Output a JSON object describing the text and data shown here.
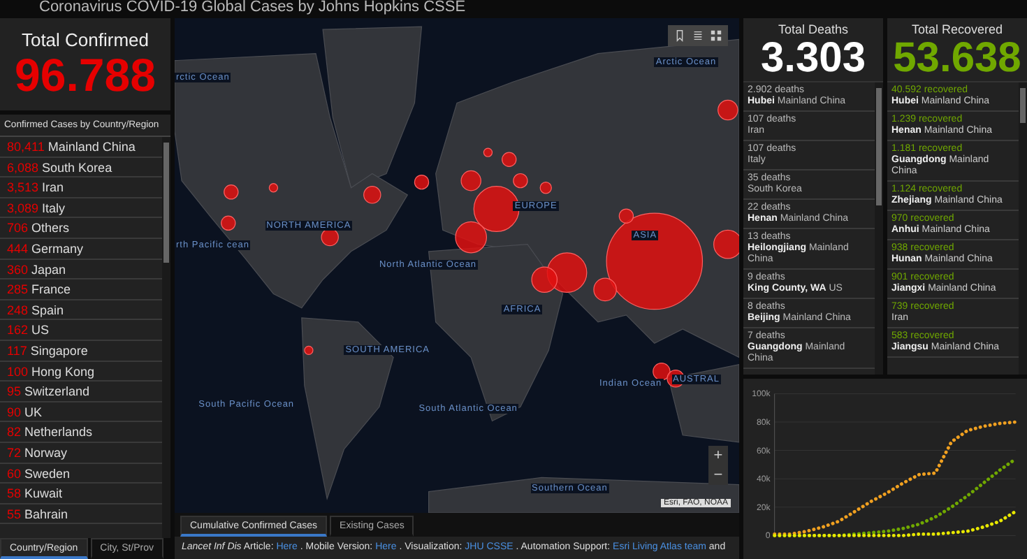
{
  "header": {
    "title": "Coronavirus COVID-19 Global Cases by Johns Hopkins CSSE"
  },
  "confirmed": {
    "label": "Total Confirmed",
    "value": "96.788"
  },
  "country_list": {
    "title": "Confirmed Cases by Country/Region",
    "rows": [
      {
        "count": "80,411",
        "name": "Mainland China"
      },
      {
        "count": "6,088",
        "name": "South Korea"
      },
      {
        "count": "3,513",
        "name": "Iran"
      },
      {
        "count": "3,089",
        "name": "Italy"
      },
      {
        "count": "706",
        "name": "Others"
      },
      {
        "count": "444",
        "name": "Germany"
      },
      {
        "count": "360",
        "name": "Japan"
      },
      {
        "count": "285",
        "name": "France"
      },
      {
        "count": "248",
        "name": "Spain"
      },
      {
        "count": "162",
        "name": "US"
      },
      {
        "count": "117",
        "name": "Singapore"
      },
      {
        "count": "100",
        "name": "Hong Kong"
      },
      {
        "count": "95",
        "name": "Switzerland"
      },
      {
        "count": "90",
        "name": "UK"
      },
      {
        "count": "82",
        "name": "Netherlands"
      },
      {
        "count": "72",
        "name": "Norway"
      },
      {
        "count": "60",
        "name": "Sweden"
      },
      {
        "count": "58",
        "name": "Kuwait"
      },
      {
        "count": "55",
        "name": "Bahrain"
      }
    ]
  },
  "list_tabs": [
    {
      "label": "Country/Region",
      "selected": true
    },
    {
      "label": "City, St/Prov",
      "selected": false
    }
  ],
  "map": {
    "labels": [
      "Arctic Ocean",
      "rctic Ocean",
      "NORTH AMERICA",
      "rth Pacific cean",
      "North Atlantic Ocean",
      "EUROPE",
      "ASIA",
      "AFRICA",
      "SOUTH AMERICA",
      "Indian Ocean",
      "AUSTRAL",
      "South Pacific Ocean",
      "South Atlantic Ocean",
      "Southern Ocean"
    ],
    "zoom_in": "+",
    "zoom_out": "−",
    "attribution": "Esri, FAO, NOAA"
  },
  "map_tabs": [
    {
      "label": "Cumulative Confirmed Cases",
      "selected": true
    },
    {
      "label": "Existing Cases",
      "selected": false
    }
  ],
  "footer": [
    {
      "text": "*Lancet Inf Dis* Article:",
      "link": false
    },
    {
      "text": "Here",
      "link": true
    },
    {
      "text": ". Mobile Version:",
      "link": false
    },
    {
      "text": "Here",
      "link": true
    },
    {
      "text": ". Visualization:",
      "link": false
    },
    {
      "text": "JHU CSSE",
      "link": true
    },
    {
      "text": ". Automation Support:",
      "link": false
    },
    {
      "text": "Esri Living Atlas team",
      "link": true
    },
    {
      "text": "and",
      "link": false
    }
  ],
  "deaths": {
    "label": "Total Deaths",
    "value": "3.303",
    "rows": [
      {
        "count": "2.902 deaths",
        "place": "Hubei",
        "region": "Mainland China"
      },
      {
        "count": "107 deaths",
        "region": "Iran"
      },
      {
        "count": "107 deaths",
        "region": "Italy"
      },
      {
        "count": "35 deaths",
        "region": "South Korea"
      },
      {
        "count": "22 deaths",
        "place": "Henan",
        "region": "Mainland China"
      },
      {
        "count": "13 deaths",
        "place": "Heilongjiang",
        "region": "Mainland China"
      },
      {
        "count": "9 deaths",
        "place": "King County, WA",
        "region": "US"
      },
      {
        "count": "8 deaths",
        "place": "Beijing",
        "region": "Mainland China"
      },
      {
        "count": "7 deaths",
        "place": "Guangdong",
        "region": "Mainland China"
      }
    ]
  },
  "recovered": {
    "label": "Total Recovered",
    "value": "53.638",
    "rows": [
      {
        "count": "40.592 recovered",
        "place": "Hubei",
        "region": "Mainland China"
      },
      {
        "count": "1.239 recovered",
        "place": "Henan",
        "region": "Mainland China"
      },
      {
        "count": "1.181 recovered",
        "place": "Guangdong",
        "region": "Mainland China"
      },
      {
        "count": "1.124 recovered",
        "place": "Zhejiang",
        "region": "Mainland China"
      },
      {
        "count": "970 recovered",
        "place": "Anhui",
        "region": "Mainland China"
      },
      {
        "count": "938 recovered",
        "place": "Hunan",
        "region": "Mainland China"
      },
      {
        "count": "901 recovered",
        "place": "Jiangxi",
        "region": "Mainland China"
      },
      {
        "count": "739 recovered",
        "region": "Iran"
      },
      {
        "count": "583 recovered",
        "place": "Jiangsu",
        "region": "Mainland China"
      }
    ]
  },
  "chart": {
    "chart_data": {
      "type": "line",
      "grid": true,
      "ylim": [
        0,
        100000
      ],
      "yticks": [
        {
          "value": 0,
          "label": "0"
        },
        {
          "value": 20000,
          "label": "20k"
        },
        {
          "value": 40000,
          "label": "40k"
        },
        {
          "value": 60000,
          "label": "60k"
        },
        {
          "value": 80000,
          "label": "80k"
        },
        {
          "value": 100000,
          "label": "100k"
        }
      ],
      "series": [
        {
          "color": "#f0a020",
          "line_style": "dotted",
          "values": [
            1000,
            1000,
            3000,
            6000,
            10000,
            17000,
            24000,
            30000,
            37000,
            43000,
            44000,
            66000,
            74000,
            77000,
            79000,
            80000
          ]
        },
        {
          "color": "#70a800",
          "line_style": "dotted",
          "values": [
            0,
            0,
            0,
            0,
            0,
            1000,
            2000,
            3000,
            5000,
            8000,
            13000,
            20000,
            28000,
            37000,
            46000,
            54000
          ]
        },
        {
          "color": "#e8e800",
          "line_style": "dotted",
          "values": [
            0,
            0,
            0,
            0,
            0,
            0,
            0,
            0,
            0,
            1000,
            1000,
            2000,
            3000,
            6000,
            10000,
            17000
          ]
        }
      ]
    }
  }
}
